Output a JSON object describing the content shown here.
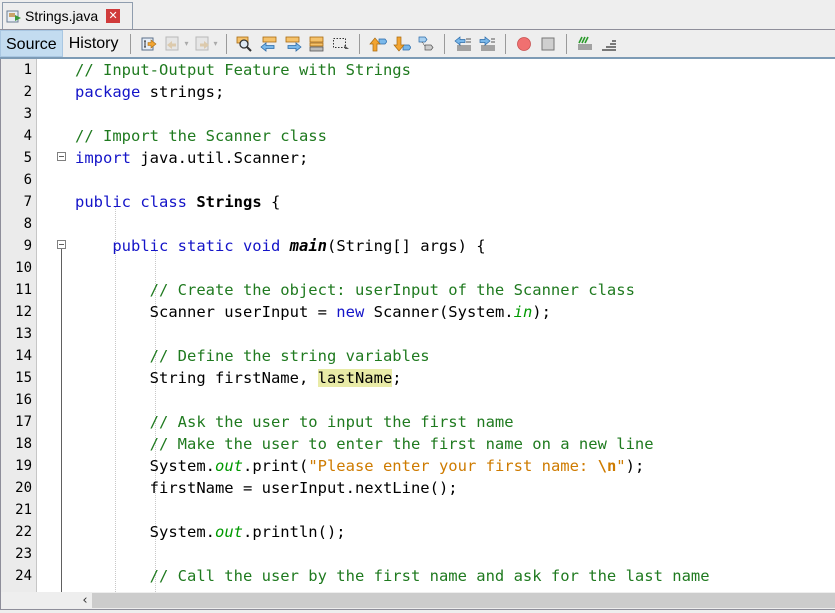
{
  "file_tab": {
    "filename": "Strings.java",
    "icon": "java-file-icon",
    "close_icon": "close-icon",
    "close_glyph": "✕"
  },
  "toolbar": {
    "source_label": "Source",
    "history_label": "History",
    "buttons": [
      {
        "name": "last-edit-icon",
        "tooltip": "Last Edit",
        "enabled": true
      },
      {
        "name": "back-icon",
        "tooltip": "Back",
        "enabled": false
      },
      {
        "name": "forward-icon",
        "tooltip": "Forward",
        "enabled": false
      },
      {
        "name": "find-icon",
        "tooltip": "Find Selection",
        "enabled": true
      },
      {
        "name": "find-previous-icon",
        "tooltip": "Find Previous Occurrence",
        "enabled": true
      },
      {
        "name": "find-next-icon",
        "tooltip": "Find Next Occurrence",
        "enabled": true
      },
      {
        "name": "toggle-highlight-icon",
        "tooltip": "Toggle Highlight Search",
        "enabled": true
      },
      {
        "name": "toggle-rect-selection-icon",
        "tooltip": "Toggle Rectangular Selection",
        "enabled": true
      },
      {
        "name": "previous-bookmark-icon",
        "tooltip": "Previous Bookmark",
        "enabled": true
      },
      {
        "name": "next-bookmark-icon",
        "tooltip": "Next Bookmark",
        "enabled": true
      },
      {
        "name": "toggle-bookmark-icon",
        "tooltip": "Toggle Bookmark",
        "enabled": true
      },
      {
        "name": "shift-left-icon",
        "tooltip": "Shift Line Left",
        "enabled": true
      },
      {
        "name": "shift-right-icon",
        "tooltip": "Shift Line Right",
        "enabled": true
      },
      {
        "name": "record-macro-icon",
        "tooltip": "Start Macro Recording",
        "enabled": true
      },
      {
        "name": "stop-macro-icon",
        "tooltip": "Stop Macro Recording",
        "enabled": true
      },
      {
        "name": "comment-icon",
        "tooltip": "Comment",
        "enabled": true
      },
      {
        "name": "uncomment-icon",
        "tooltip": "Uncomment",
        "enabled": true
      }
    ]
  },
  "editor": {
    "line_numbers": [
      "1",
      "2",
      "3",
      "4",
      "5",
      "6",
      "7",
      "8",
      "9",
      "10",
      "11",
      "12",
      "13",
      "14",
      "15",
      "16",
      "17",
      "18",
      "19",
      "20",
      "21",
      "22",
      "23",
      "24"
    ],
    "lines": [
      [
        {
          "t": "// Input-Output Feature with Strings",
          "c": "comment"
        }
      ],
      [
        {
          "t": "package",
          "c": "kw"
        },
        {
          "t": " strings;",
          "c": ""
        }
      ],
      [],
      [
        {
          "t": "// Import the Scanner class",
          "c": "comment"
        }
      ],
      [
        {
          "t": "import",
          "c": "kw"
        },
        {
          "t": " java.util.Scanner;",
          "c": ""
        }
      ],
      [],
      [
        {
          "t": "public class",
          "c": "kw"
        },
        {
          "t": " ",
          "c": ""
        },
        {
          "t": "Strings",
          "c": "bold"
        },
        {
          "t": " {",
          "c": ""
        }
      ],
      [],
      [
        {
          "t": "    public static void",
          "c": "kw"
        },
        {
          "t": " ",
          "c": ""
        },
        {
          "t": "main",
          "c": "method"
        },
        {
          "t": "(String[] args) {",
          "c": ""
        }
      ],
      [],
      [
        {
          "t": "        // Create the object: userInput of the Scanner class",
          "c": "comment"
        }
      ],
      [
        {
          "t": "        Scanner userInput = ",
          "c": ""
        },
        {
          "t": "new",
          "c": "kw"
        },
        {
          "t": " Scanner(System.",
          "c": ""
        },
        {
          "t": "in",
          "c": "field"
        },
        {
          "t": ");",
          "c": ""
        }
      ],
      [],
      [
        {
          "t": "        // Define the string variables",
          "c": "comment"
        }
      ],
      [
        {
          "t": "        String firstName, ",
          "c": ""
        },
        {
          "t": "lastName",
          "c": "hl"
        },
        {
          "t": ";",
          "c": ""
        }
      ],
      [],
      [
        {
          "t": "        // Ask the user to input the first name",
          "c": "comment"
        }
      ],
      [
        {
          "t": "        // Make the user to enter the first name on a new line",
          "c": "comment"
        }
      ],
      [
        {
          "t": "        System.",
          "c": ""
        },
        {
          "t": "out",
          "c": "field"
        },
        {
          "t": ".print(",
          "c": ""
        },
        {
          "t": "\"Please enter your first name: ",
          "c": "str"
        },
        {
          "t": "\\n",
          "c": "esc"
        },
        {
          "t": "\"",
          "c": "str"
        },
        {
          "t": ");",
          "c": ""
        }
      ],
      [
        {
          "t": "        firstName = userInput.nextLine();",
          "c": ""
        }
      ],
      [],
      [
        {
          "t": "        System.",
          "c": ""
        },
        {
          "t": "out",
          "c": "field"
        },
        {
          "t": ".println();",
          "c": ""
        }
      ],
      [],
      [
        {
          "t": "        // Call the user by the first name and ask for the last name",
          "c": "comment"
        }
      ]
    ],
    "fold_markers_lines": [
      5,
      9
    ],
    "highlighted_word": "lastName"
  },
  "scrollbar": {
    "left_arrow_glyph": "‹"
  },
  "colors": {
    "comment": "#1f7a1f",
    "keyword": "#1414c8",
    "string": "#ce7b00",
    "field": "#009900",
    "highlight": "#e9eba7",
    "source_tab_active": "#c3dcf0"
  }
}
